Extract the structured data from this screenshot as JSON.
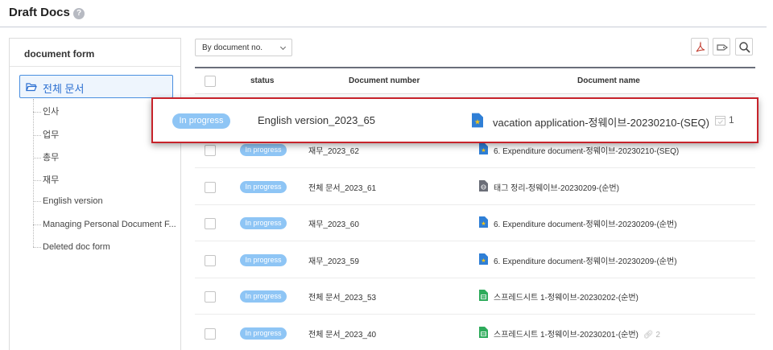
{
  "header": {
    "title": "Draft Docs",
    "help_icon": "?"
  },
  "sidebar": {
    "title": "document form",
    "root": {
      "label": "전체 문서",
      "icon": "folder-open-icon"
    },
    "items": [
      {
        "label": "인사"
      },
      {
        "label": "업무"
      },
      {
        "label": "총무"
      },
      {
        "label": "재무"
      },
      {
        "label": "English version"
      },
      {
        "label": "Managing Personal Document F..."
      },
      {
        "label": "Deleted doc form"
      }
    ]
  },
  "toolbar": {
    "sort_select": "By document no.",
    "icons": [
      "pdf-icon",
      "tag-icon",
      "search-icon"
    ]
  },
  "table": {
    "headers": {
      "status": "status",
      "number": "Document number",
      "name": "Document name"
    },
    "rows": [
      {
        "status": "In progress",
        "number": "재무_2023_62",
        "name": "6. Expenditure document-정웨이브-20230210-(SEQ)",
        "icon": "star-doc-icon"
      },
      {
        "status": "In progress",
        "number": "전체 문서_2023_61",
        "name": "태그 정리-정웨이브-20230209-(순번)",
        "icon": "globe-doc-icon"
      },
      {
        "status": "In progress",
        "number": "재무_2023_60",
        "name": "6. Expenditure document-정웨이브-20230209-(순번)",
        "icon": "star-doc-icon"
      },
      {
        "status": "In progress",
        "number": "재무_2023_59",
        "name": "6. Expenditure document-정웨이브-20230209-(순번)",
        "icon": "star-doc-icon"
      },
      {
        "status": "In progress",
        "number": "전체 문서_2023_53",
        "name": "스프레드시트 1-정웨이브-20230202-(순번)",
        "icon": "sheet-doc-icon"
      },
      {
        "status": "In progress",
        "number": "전체 문서_2023_40",
        "name": "스프레드시트 1-정웨이브-20230201-(순번)",
        "icon": "sheet-doc-icon",
        "attachments": "2"
      }
    ]
  },
  "dragging_row": {
    "status": "In progress",
    "number": "English version_2023_65",
    "name": "vacation application-정웨이브-20230210-(SEQ)",
    "count": "1",
    "colors": {
      "border": "#c7232b",
      "badge": "#8ec5f5"
    }
  }
}
